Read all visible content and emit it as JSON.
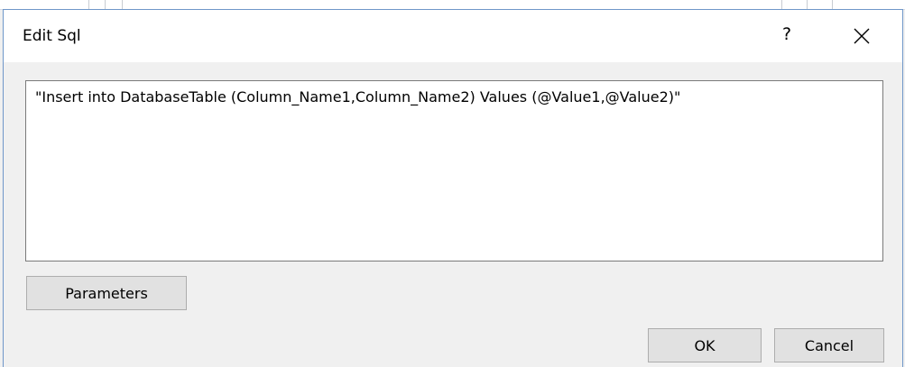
{
  "window": {
    "title": "Edit Sql",
    "help_glyph": "?",
    "help_icon": "help-icon",
    "close_icon": "close-icon"
  },
  "editor": {
    "sql_text": "\"Insert into DatabaseTable (Column_Name1,Column_Name2) Values (@Value1,@Value2)\""
  },
  "buttons": {
    "parameters_label": "Parameters",
    "ok_label": "OK",
    "cancel_label": "Cancel"
  },
  "colors": {
    "dialog_border": "#6f97c9",
    "dialog_background": "#f0f0f0",
    "button_face": "#e1e1e1"
  }
}
